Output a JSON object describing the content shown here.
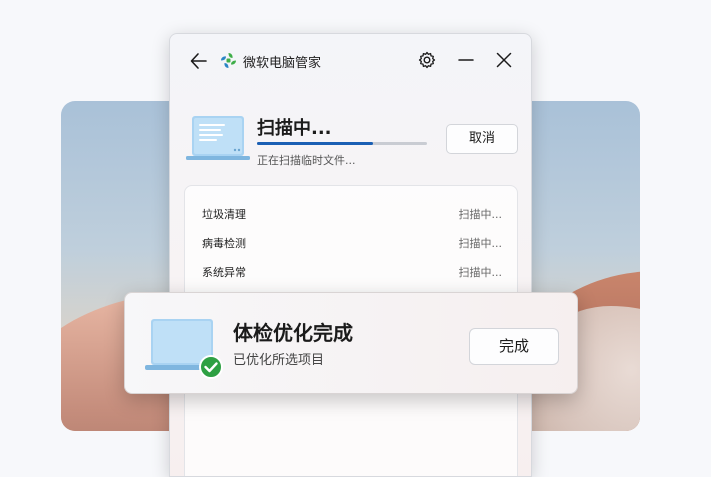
{
  "window": {
    "title": "微软电脑管家"
  },
  "scan": {
    "title": "扫描中...",
    "subtitle": "正在扫描临时文件...",
    "cancel_label": "取消",
    "progress": 0.68
  },
  "results": [
    {
      "name": "垃圾清理",
      "status": "扫描中..."
    },
    {
      "name": "病毒检测",
      "status": "扫描中..."
    },
    {
      "name": "系统异常",
      "status": "扫描中..."
    }
  ],
  "toast": {
    "title": "体检优化完成",
    "subtitle": "已优化所选项目",
    "done_label": "完成"
  },
  "colors": {
    "accent": "#1a5fb4",
    "success": "#2ea043",
    "logo_green": "#3fae49",
    "logo_blue": "#2b86c5"
  },
  "icons": {
    "back": "back-arrow-icon",
    "logo": "pc-manager-logo-icon",
    "settings": "gear-icon",
    "minimize": "minimize-icon",
    "close": "close-icon",
    "laptop": "laptop-icon",
    "success": "checkmark-icon"
  }
}
